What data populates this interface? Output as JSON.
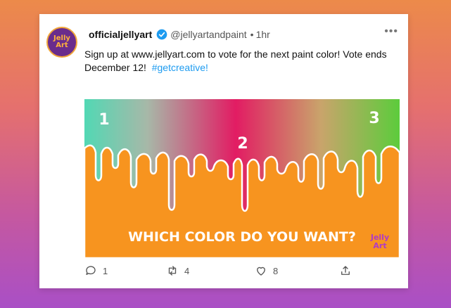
{
  "account": {
    "display_name": "officialjellyart",
    "handle": "@jellyartandpaint",
    "time": "1hr",
    "avatar_text": [
      "Jelly",
      "Art"
    ]
  },
  "tweet": {
    "text": "Sign up at www.jellyart.com to vote for the next paint color! Vote ends December 12!",
    "hashtag": "#getcreative!"
  },
  "media": {
    "labels": [
      "1",
      "2",
      "3"
    ],
    "headline": "WHICH COLOR DO YOU WANT?",
    "logo_text": [
      "Jelly",
      "Art"
    ],
    "colors": {
      "color1": "#52d8b4",
      "color2": "#e21c63",
      "color3": "#5ccc3c",
      "paint": "#f7941f"
    }
  },
  "actions": {
    "reply_count": "1",
    "retweet_count": "4",
    "like_count": "8"
  },
  "colors": {
    "link": "#1d9bf0",
    "verified": "#1d9bf0"
  },
  "icons": [
    "verified-badge-icon",
    "more-icon",
    "reply-icon",
    "retweet-icon",
    "like-icon",
    "share-icon"
  ]
}
